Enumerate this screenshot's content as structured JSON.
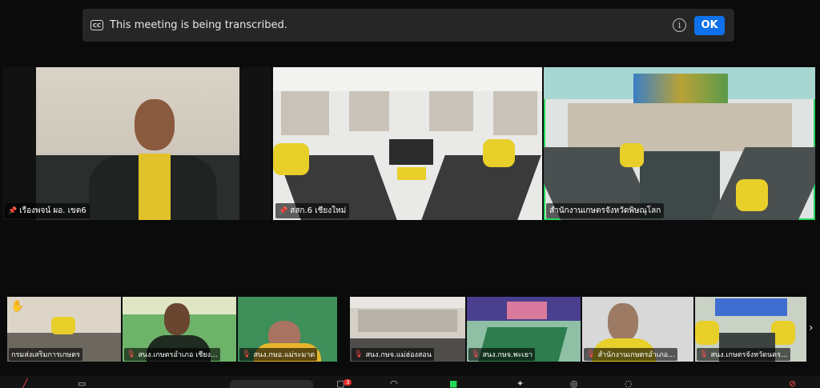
{
  "banner": {
    "cc_icon": "closed-captions-icon",
    "text": "This meeting is being transcribed.",
    "info_icon": "info-icon",
    "ok_label": "OK"
  },
  "main_tiles": [
    {
      "name": "เรืองพจน์ ผอ. เขต6",
      "pinned": true,
      "active": false
    },
    {
      "name": "สสก.6 เชียงใหม่",
      "pinned": true,
      "active": false
    },
    {
      "name": "สำนักงานเกษตรจังหวัดพิษณุโลก",
      "pinned": false,
      "active": true
    }
  ],
  "gallery": [
    {
      "name": "กรมส่งเสริมการเกษตร",
      "muted": false,
      "hand_raised": true
    },
    {
      "name": "สนง.เกษตรอำเภอ เชียง...",
      "muted": true,
      "hand_raised": false
    },
    {
      "name": "สนง.กษอ.แม่ระมาด",
      "muted": true,
      "hand_raised": false
    },
    {
      "name": "สนง.กษจ.แม่ฮ่องสอน",
      "muted": true,
      "hand_raised": false
    },
    {
      "name": "สนง.กษจ.พะเยา",
      "muted": true,
      "hand_raised": false
    },
    {
      "name": "สำนักงานเกษตรอำเภอ...",
      "muted": true,
      "hand_raised": false
    },
    {
      "name": "สนง.เกษตรจังหวัดนคร...",
      "muted": true,
      "hand_raised": false
    }
  ],
  "toolbar": {
    "chat_badge": "3"
  },
  "colors": {
    "active_speaker": "#23d959",
    "ok_button": "#0e71eb",
    "banner_bg": "#262626",
    "muted": "#ff4a4a"
  }
}
